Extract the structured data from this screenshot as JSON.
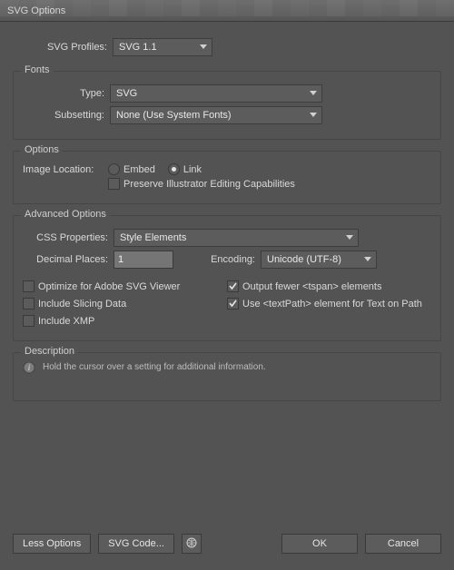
{
  "window": {
    "title": "SVG Options"
  },
  "profiles": {
    "label": "SVG Profiles:",
    "value": "SVG 1.1"
  },
  "fonts": {
    "legend": "Fonts",
    "type_label": "Type:",
    "type_value": "SVG",
    "subsetting_label": "Subsetting:",
    "subsetting_value": "None (Use System Fonts)"
  },
  "options": {
    "legend": "Options",
    "image_location_label": "Image Location:",
    "embed_label": "Embed",
    "link_label": "Link",
    "image_location_selected": "link",
    "preserve_label": "Preserve Illustrator Editing Capabilities",
    "preserve_checked": false
  },
  "advanced": {
    "legend": "Advanced Options",
    "css_label": "CSS Properties:",
    "css_value": "Style Elements",
    "decimal_label": "Decimal Places:",
    "decimal_value": "1",
    "encoding_label": "Encoding:",
    "encoding_value": "Unicode (UTF-8)",
    "optimize_label": "Optimize for Adobe SVG Viewer",
    "optimize_checked": false,
    "output_tspan_label": "Output fewer <tspan> elements",
    "output_tspan_checked": true,
    "slicing_label": "Include Slicing Data",
    "slicing_checked": false,
    "textpath_label": "Use <textPath> element for Text on Path",
    "textpath_checked": true,
    "xmp_label": "Include XMP",
    "xmp_checked": false
  },
  "description": {
    "legend": "Description",
    "hint": "Hold the cursor over a setting for additional information."
  },
  "footer": {
    "less_options": "Less Options",
    "svg_code": "SVG Code...",
    "ok": "OK",
    "cancel": "Cancel"
  }
}
